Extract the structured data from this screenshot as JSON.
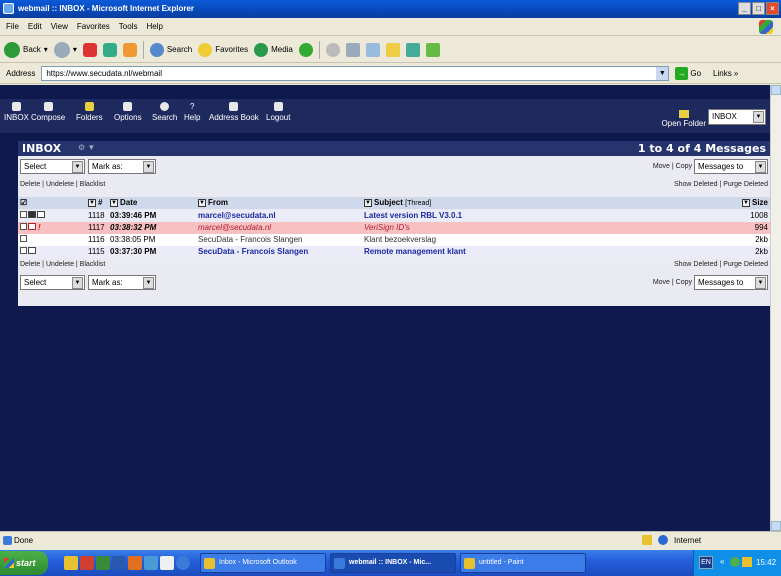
{
  "window": {
    "title": "webmail :: INBOX - Microsoft Internet Explorer"
  },
  "menu": [
    "File",
    "Edit",
    "View",
    "Favorites",
    "Tools",
    "Help"
  ],
  "toolbar": {
    "back": "Back",
    "search": "Search",
    "favorites": "Favorites",
    "media": "Media"
  },
  "address": {
    "label": "Address",
    "url": "https://www.secudata.nl/webmail",
    "go": "Go",
    "links": "Links »"
  },
  "nav": [
    {
      "label": "INBOX",
      "icon": "inbox-icon"
    },
    {
      "label": "Compose",
      "icon": "compose-icon"
    },
    {
      "label": "Folders",
      "icon": "folders-icon"
    },
    {
      "label": "Options",
      "icon": "options-icon"
    },
    {
      "label": "Search",
      "icon": "search-icon"
    },
    {
      "label": "Help",
      "icon": "help-icon"
    },
    {
      "label": "Address Book",
      "icon": "address-book-icon"
    },
    {
      "label": "Logout",
      "icon": "logout-icon"
    }
  ],
  "open_folder": {
    "label": "Open Folder",
    "value": "INBOX"
  },
  "inbox": {
    "title": "INBOX",
    "count": "1 to 4 of 4 Messages"
  },
  "controls_top": {
    "select": "Select",
    "mark_as": "Mark as:",
    "move_copy": "Move | Copy",
    "messages_to": "Messages to"
  },
  "actions": {
    "left": "Delete | Undelete | Blacklist",
    "right": "Show Deleted | Purge Deleted"
  },
  "columns": {
    "num": "#",
    "date": "Date",
    "from": "From",
    "subject": "Subject",
    "thread": "[Thread]",
    "size": "Size"
  },
  "messages": [
    {
      "num": "1118",
      "time": "03:39:46 PM",
      "from": "marcel@secudata.nl",
      "subject": "Latest version RBL V3.0.1",
      "size": "1008"
    },
    {
      "num": "1117",
      "time": "03:38:32 PM",
      "from": "marcel@secudata.nl",
      "subject": "VeriSign ID's",
      "size": "994"
    },
    {
      "num": "1116",
      "time": "03:38:05 PM",
      "from": "SecuData - Francois Slangen",
      "subject": "Klant bezoekverslag",
      "size": "2kb"
    },
    {
      "num": "1115",
      "time": "03:37:30 PM",
      "from": "SecuData - Francois Slangen",
      "subject": "Remote management klant",
      "size": "2kb"
    }
  ],
  "status": {
    "text": "Done",
    "zone": "Internet"
  },
  "taskbar": {
    "start": "start",
    "tasks": [
      "Inbox - Microsoft Outlook",
      "webmail :: INBOX - Mic...",
      "untitled - Paint"
    ],
    "lang": "EN",
    "clock": "15:42"
  },
  "colors": {
    "page_bg": "#0e1a4e",
    "nav_bg": "#1e2a5e",
    "highlight_row": "#f8c0c0",
    "header_row": "#d0d8ec"
  }
}
